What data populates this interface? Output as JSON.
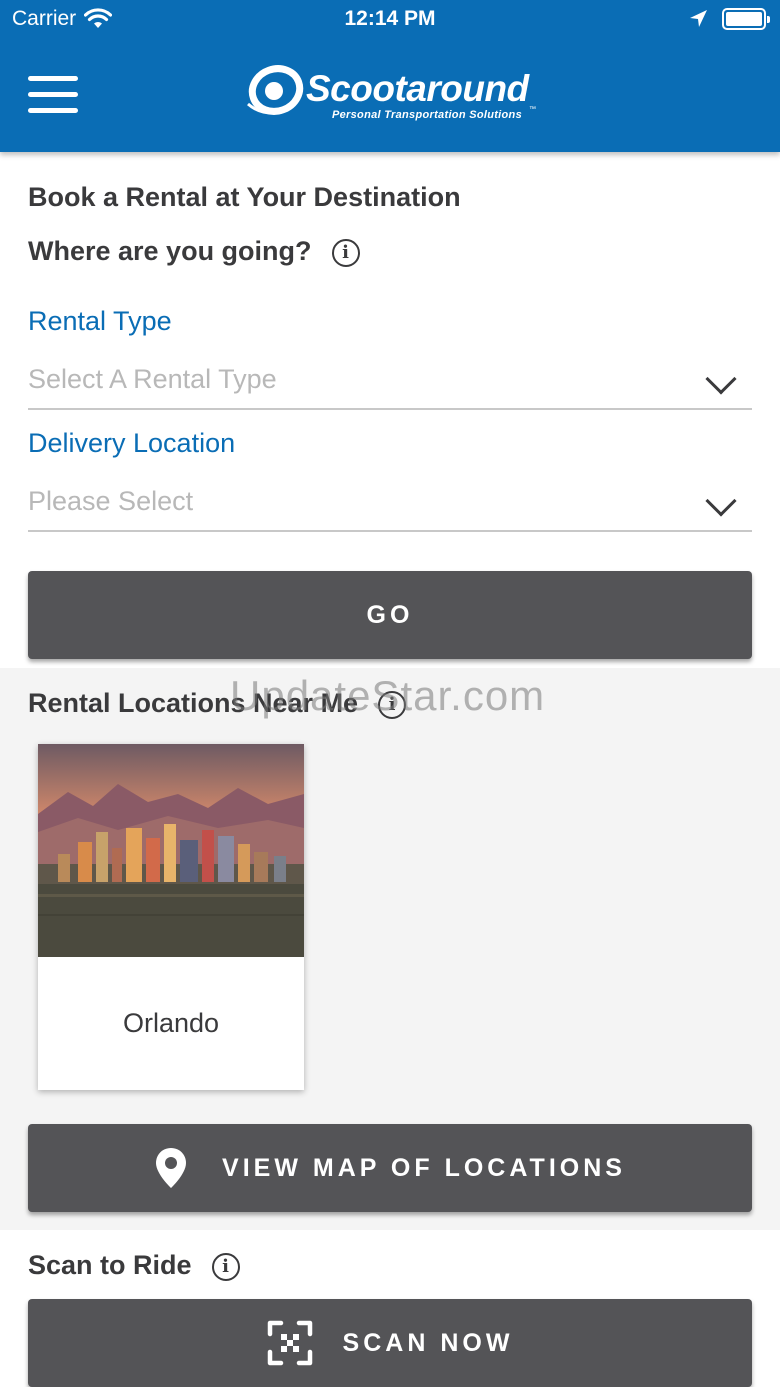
{
  "status_bar": {
    "carrier": "Carrier",
    "time": "12:14 PM"
  },
  "header": {
    "logo_name": "Scootaround",
    "logo_tagline": "Personal Transportation Solutions",
    "logo_trademark": "™"
  },
  "booking": {
    "title": "Book a Rental at Your Destination",
    "question": "Where are you going?",
    "rental_type": {
      "label": "Rental Type",
      "placeholder": "Select A Rental Type"
    },
    "delivery_location": {
      "label": "Delivery Location",
      "placeholder": "Please Select"
    },
    "go_button": "GO"
  },
  "nearby": {
    "title": "Rental Locations Near Me",
    "cards": [
      {
        "name": "Orlando"
      }
    ],
    "map_button": "VIEW MAP OF LOCATIONS"
  },
  "scan": {
    "title": "Scan to Ride",
    "button": "SCAN NOW"
  },
  "watermark": "UpdateStar.com",
  "colors": {
    "brand_blue": "#0a6db5",
    "button_gray": "#545457",
    "section_gray": "#f4f4f4"
  }
}
